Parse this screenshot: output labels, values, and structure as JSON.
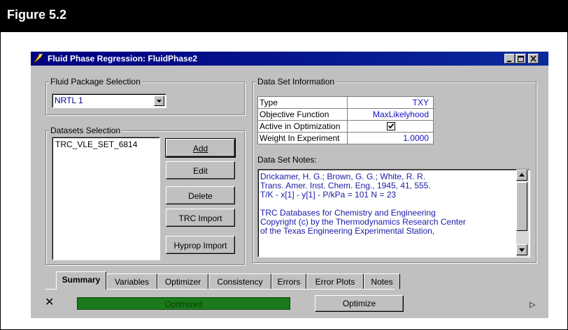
{
  "figure": {
    "title": "Figure 5.2"
  },
  "window": {
    "title": "Fluid Phase Regression:  FluidPhase2",
    "icon": "fluid-regression-icon",
    "controls": [
      "minimize-icon",
      "maximize-icon",
      "close-icon"
    ]
  },
  "fluid_package": {
    "group_label": "Fluid Package Selection",
    "selected": "NRTL 1"
  },
  "datasets": {
    "group_label": "Datasets Selection",
    "items": [
      "TRC_VLE_SET_6814"
    ],
    "buttons": {
      "add": "Add",
      "edit": "Edit",
      "delete": "Delete",
      "trc_import": "TRC Import",
      "hyprop_import": "Hyprop Import"
    }
  },
  "dataset_info": {
    "group_label": "Data Set Information",
    "rows": [
      {
        "label": "Type",
        "value": "TXY"
      },
      {
        "label": "Objective Function",
        "value": "MaxLikelyhood"
      },
      {
        "label": "Active in Optimization",
        "checked": true
      },
      {
        "label": "Weight In Experiment",
        "value": "1.0000"
      }
    ],
    "notes_label": "Data Set Notes:",
    "notes_lines": [
      "Drickamer, H. G.; Brown, G. G.; White, R. R.",
      "Trans. Amer. Inst. Chem. Eng., 1945, 41, 555.",
      "T/K - x[1] - y[1]  - P/kPa = 101  N = 23",
      "",
      "TRC Databases for Chemistry and Engineering",
      "Copyright (c) by the Thermodynamics Research Center",
      "of the Texas Engineering Experimental Station,"
    ]
  },
  "tabs": [
    {
      "label": "Summary",
      "active": true
    },
    {
      "label": "Variables"
    },
    {
      "label": "Optimizer"
    },
    {
      "label": "Consistency"
    },
    {
      "label": "Errors"
    },
    {
      "label": "Error Plots"
    },
    {
      "label": "Notes"
    }
  ],
  "status": {
    "progress_text": "Optimized",
    "progress_fraction": 1.0,
    "progress_color": "#1a7a1a",
    "optimize_button": "Optimize",
    "close_glyph": "✕",
    "arrow_glyph": "▷"
  },
  "colors": {
    "title_bar": "#000080",
    "window_bg": "#c0c0c0",
    "value_text": "#1010c0"
  }
}
